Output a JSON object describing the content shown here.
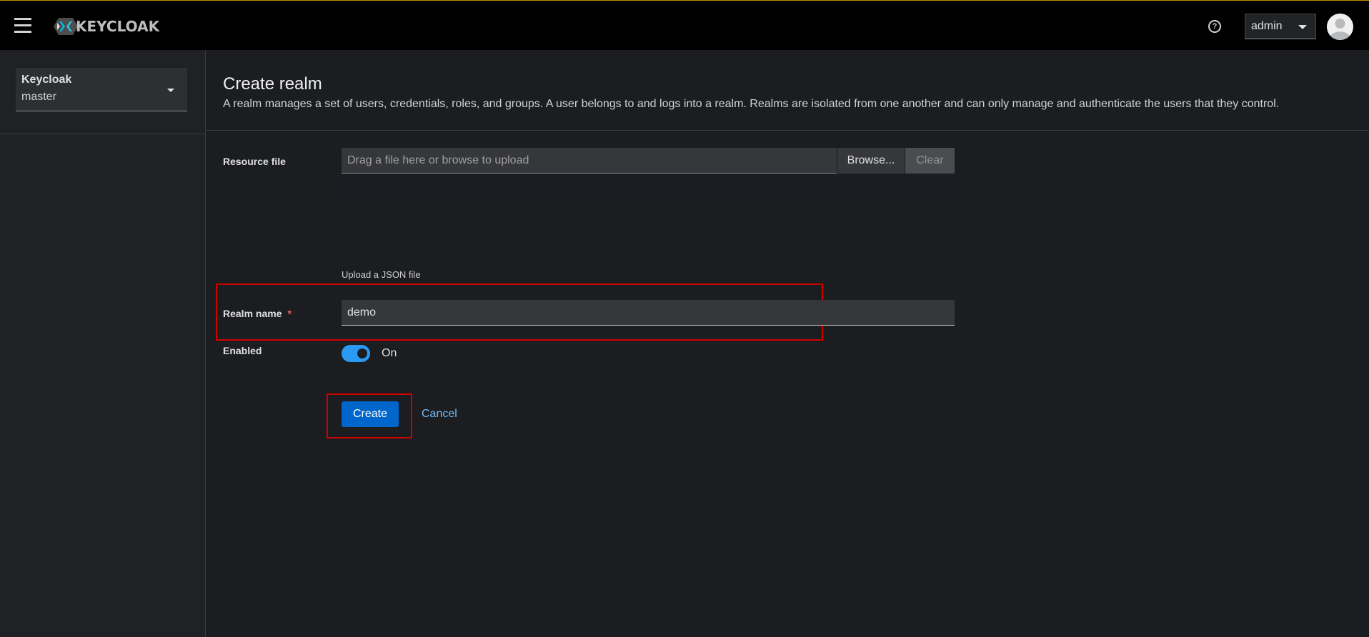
{
  "header": {
    "brand": "KEYCLOAK",
    "user": "admin",
    "accent_color": "#c58c00"
  },
  "sidebar": {
    "realm_selector": {
      "title": "Keycloak",
      "value": "master"
    }
  },
  "page": {
    "title": "Create realm",
    "description": "A realm manages a set of users, credentials, roles, and groups. A user belongs to and logs into a realm. Realms are isolated from one another and can only manage and authenticate the users that they control."
  },
  "form": {
    "resource_file": {
      "label": "Resource file",
      "placeholder": "Drag a file here or browse to upload",
      "browse_label": "Browse...",
      "clear_label": "Clear",
      "helper": "Upload a JSON file"
    },
    "realm_name": {
      "label": "Realm name",
      "required_mark": "*",
      "value": "demo"
    },
    "enabled": {
      "label": "Enabled",
      "state_label": "On",
      "checked": true
    },
    "actions": {
      "create_label": "Create",
      "cancel_label": "Cancel"
    }
  },
  "colors": {
    "primary_button": "#0066cc",
    "link": "#73bcf7",
    "toggle_on": "#2b9af3",
    "highlight": "#d10000"
  },
  "icons": {
    "menu": "hamburger-icon",
    "help": "help-icon",
    "logo": "keycloak-logo-icon",
    "avatar": "user-avatar-icon"
  }
}
